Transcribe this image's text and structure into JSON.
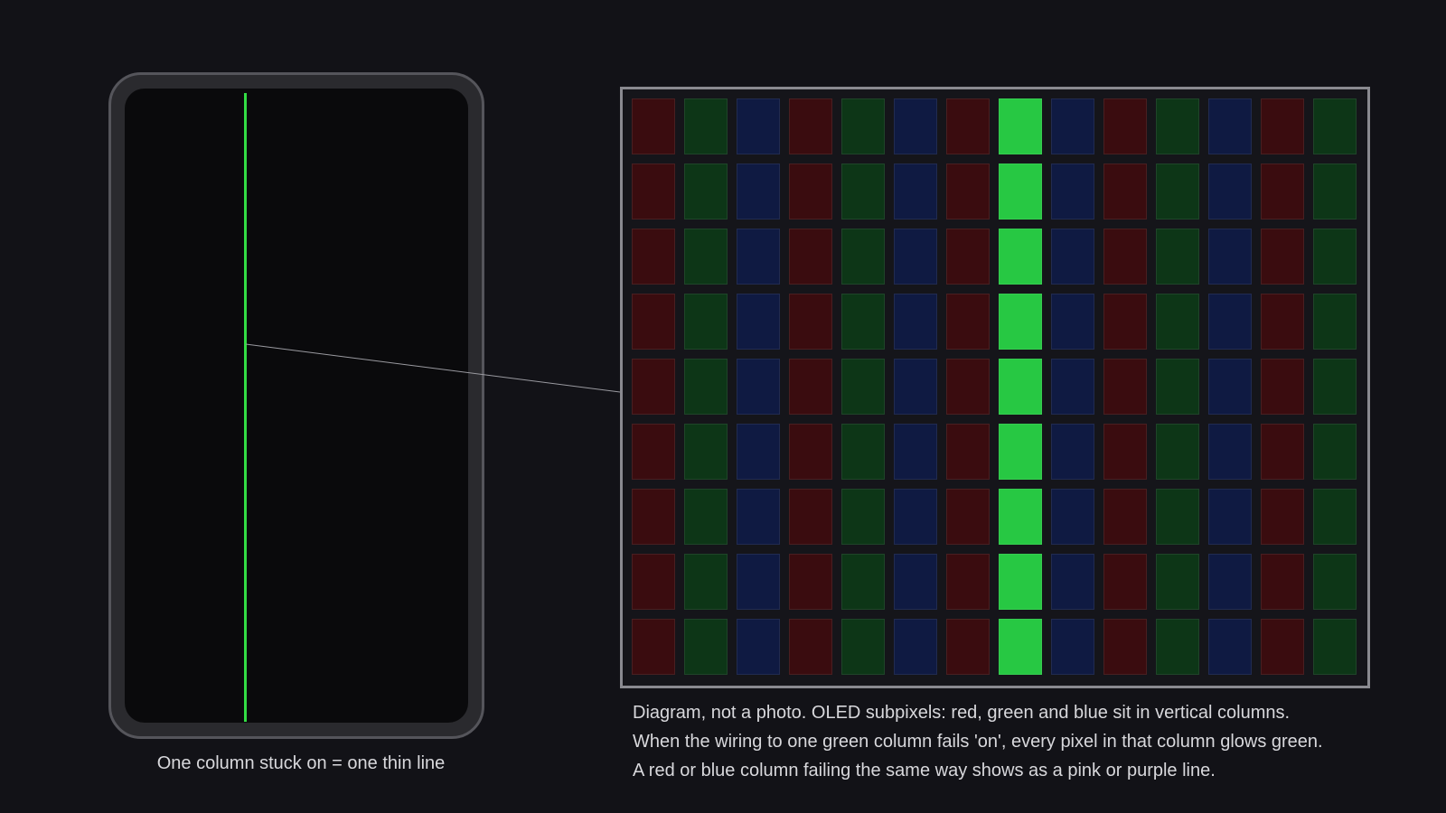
{
  "phone": {
    "caption": "One column stuck on = one thin line",
    "line_color": "#33dd44"
  },
  "zoom": {
    "rows": 9,
    "columns": [
      "red",
      "green",
      "blue",
      "red",
      "green",
      "blue",
      "red",
      "green",
      "blue",
      "red",
      "green",
      "blue",
      "red",
      "green"
    ],
    "stuck_column_index": 7,
    "colors": {
      "red_off": "#3a0c0f",
      "green_off": "#0d3617",
      "blue_off": "#0f1a42",
      "green_on": "#27c843"
    }
  },
  "note": {
    "lines": [
      "Diagram, not a photo. OLED subpixels: red, green and blue sit in vertical columns.",
      "When the wiring to one green column fails 'on', every pixel in that column glows green.",
      "A red or blue column failing the same way shows as a pink or purple line."
    ]
  }
}
